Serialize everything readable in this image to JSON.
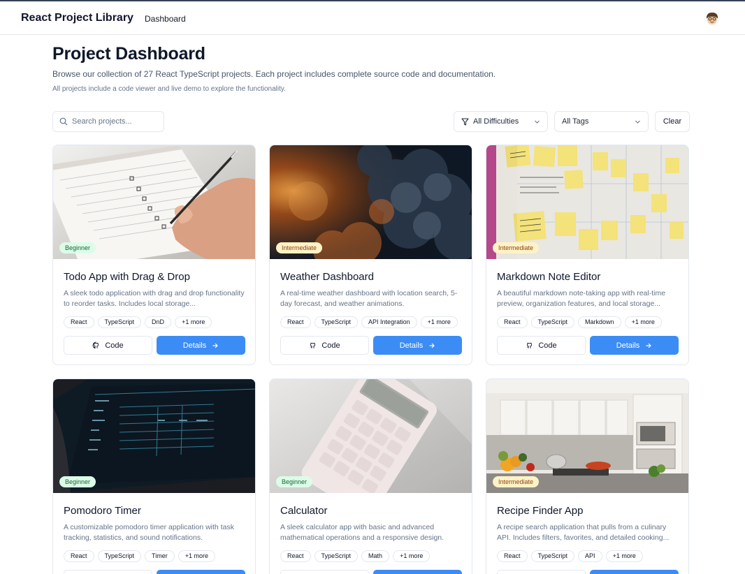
{
  "header": {
    "brand": "React Project Library",
    "nav_dashboard": "Dashboard",
    "avatar_icon": "user-avatar-icon"
  },
  "page": {
    "title": "Project Dashboard",
    "subtitle": "Browse our collection of 27 React TypeScript projects. Each project includes complete source code and documentation.",
    "note": "All projects include a code viewer and live demo to explore the functionality."
  },
  "filters": {
    "search_placeholder": "Search projects...",
    "difficulty": "All Difficulties",
    "tags": "All Tags",
    "clear": "Clear"
  },
  "buttons": {
    "code": "Code",
    "details": "Details"
  },
  "colors": {
    "primary": "#3b8cf5",
    "beginner_bg": "#dcfce7",
    "beginner_text": "#166534",
    "intermediate_bg": "#fef3c7",
    "intermediate_text": "#92400e"
  },
  "projects": [
    {
      "difficulty": "Beginner",
      "title": "Todo App with Drag & Drop",
      "description": "A sleek todo application with drag and drop functionality to reorder tasks. Includes local storage...",
      "tags": [
        "React",
        "TypeScript",
        "DnD",
        "+1 more"
      ]
    },
    {
      "difficulty": "Intermediate",
      "title": "Weather Dashboard",
      "description": "A real-time weather dashboard with location search, 5-day forecast, and weather animations.",
      "tags": [
        "React",
        "TypeScript",
        "API Integration",
        "+1 more"
      ]
    },
    {
      "difficulty": "Intermediate",
      "title": "Markdown Note Editor",
      "description": "A beautiful markdown note-taking app with real-time preview, organization features, and local storage...",
      "tags": [
        "React",
        "TypeScript",
        "Markdown",
        "+1 more"
      ]
    },
    {
      "difficulty": "Beginner",
      "title": "Pomodoro Timer",
      "description": "A customizable pomodoro timer application with task tracking, statistics, and sound notifications.",
      "tags": [
        "React",
        "TypeScript",
        "Timer",
        "+1 more"
      ]
    },
    {
      "difficulty": "Beginner",
      "title": "Calculator",
      "description": "A sleek calculator app with basic and advanced mathematical operations and a responsive design.",
      "tags": [
        "React",
        "TypeScript",
        "Math",
        "+1 more"
      ]
    },
    {
      "difficulty": "Intermediate",
      "title": "Recipe Finder App",
      "description": "A recipe search application that pulls from a culinary API. Includes filters, favorites, and detailed cooking...",
      "tags": [
        "React",
        "TypeScript",
        "API",
        "+1 more"
      ]
    }
  ]
}
